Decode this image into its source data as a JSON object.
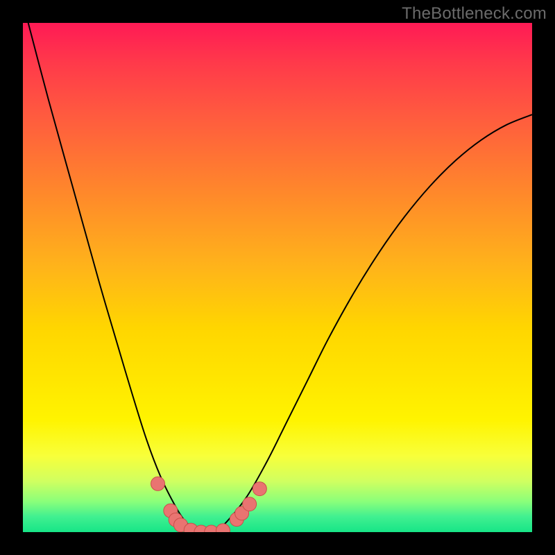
{
  "watermark": {
    "text": "TheBottleneck.com"
  },
  "chart_data": {
    "type": "line",
    "title": "",
    "xlabel": "",
    "ylabel": "",
    "xlim": [
      0,
      1
    ],
    "ylim": [
      0,
      1
    ],
    "grid": false,
    "series": [
      {
        "name": "curve",
        "x": [
          0.0,
          0.05,
          0.1,
          0.15,
          0.2,
          0.24,
          0.27,
          0.3,
          0.32,
          0.34,
          0.36,
          0.38,
          0.4,
          0.44,
          0.48,
          0.52,
          0.56,
          0.6,
          0.65,
          0.7,
          0.75,
          0.8,
          0.85,
          0.9,
          0.95,
          1.0
        ],
        "y": [
          1.04,
          0.85,
          0.67,
          0.49,
          0.32,
          0.19,
          0.11,
          0.05,
          0.02,
          0.005,
          0.0,
          0.005,
          0.02,
          0.07,
          0.14,
          0.22,
          0.3,
          0.38,
          0.47,
          0.55,
          0.62,
          0.68,
          0.73,
          0.77,
          0.8,
          0.82
        ]
      }
    ],
    "markers": [
      {
        "x": 0.265,
        "y": 0.095
      },
      {
        "x": 0.29,
        "y": 0.042
      },
      {
        "x": 0.3,
        "y": 0.024
      },
      {
        "x": 0.31,
        "y": 0.014
      },
      {
        "x": 0.33,
        "y": 0.004
      },
      {
        "x": 0.35,
        "y": 0.0
      },
      {
        "x": 0.37,
        "y": 0.0
      },
      {
        "x": 0.393,
        "y": 0.003
      },
      {
        "x": 0.42,
        "y": 0.025
      },
      {
        "x": 0.43,
        "y": 0.037
      },
      {
        "x": 0.445,
        "y": 0.055
      },
      {
        "x": 0.465,
        "y": 0.085
      }
    ],
    "colors": {
      "curve": "#000000",
      "marker_fill": "#e97471",
      "marker_stroke": "#c94f4a"
    }
  }
}
